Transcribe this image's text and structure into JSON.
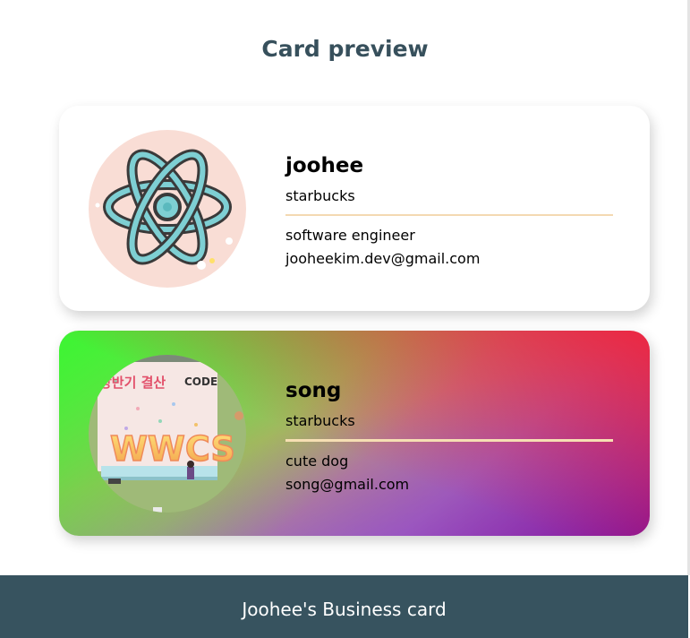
{
  "page": {
    "title": "Card preview"
  },
  "cards": [
    {
      "name": "joohee",
      "company": "starbucks",
      "title": "software engineer",
      "email": "jooheekim.dev@gmail.com",
      "avatar_icon": "react-atom-icon",
      "theme": "light"
    },
    {
      "name": "song",
      "company": "starbucks",
      "title": "cute dog",
      "email": "song@gmail.com",
      "avatar_icon": "wwcs-photo",
      "theme": "rainbow",
      "photo_text": {
        "top_left": "상반기 결산",
        "top_right": "CODE",
        "banner": "WWCS"
      }
    }
  ],
  "footer": {
    "text": "Joohee's Business card"
  },
  "colors": {
    "title": "#37505c",
    "footer_bg": "#37535f",
    "avatar_bg": "#f9ddd5",
    "divider": "#f4d9b2"
  }
}
